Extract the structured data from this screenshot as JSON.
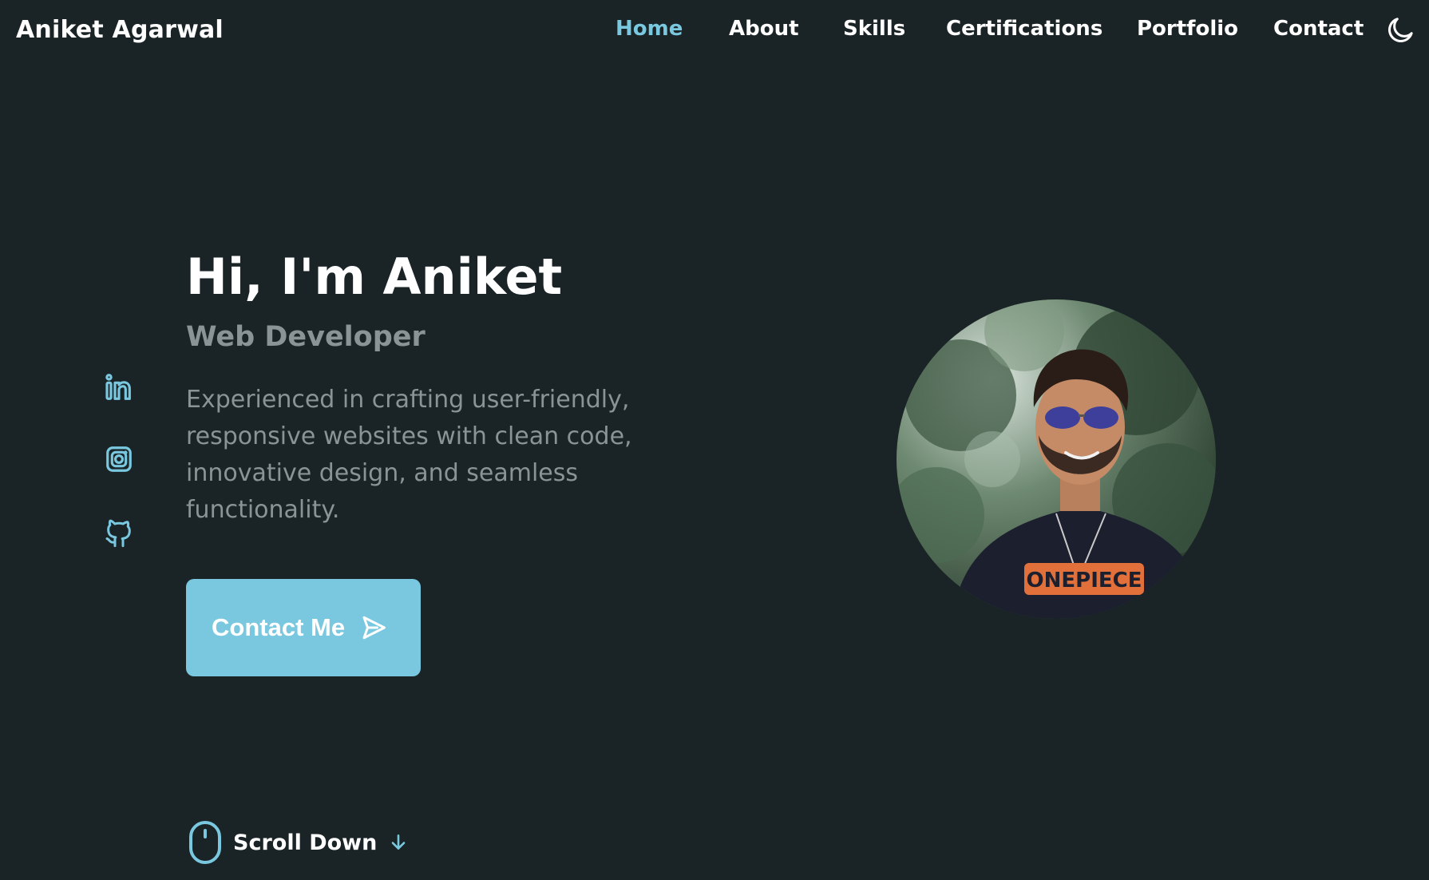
{
  "header": {
    "logo": "Aniket Agarwal",
    "nav": [
      {
        "label": "Home",
        "active": true
      },
      {
        "label": "About"
      },
      {
        "label": "Skills"
      },
      {
        "label": "Certifications"
      },
      {
        "label": "Portfolio"
      },
      {
        "label": "Contact"
      }
    ],
    "theme_icon": "moon-icon"
  },
  "hero": {
    "title": "Hi, I'm Aniket",
    "subtitle": "Web Developer",
    "description": "Experienced in crafting user-friendly, responsive websites with clean code, innovative design, and seamless functionality.",
    "cta_label": "Contact Me",
    "cta_icon": "send-icon"
  },
  "social": [
    {
      "icon": "linkedin-icon"
    },
    {
      "icon": "instagram-icon"
    },
    {
      "icon": "github-icon"
    }
  ],
  "scroll": {
    "label": "Scroll Down",
    "icons": [
      "mouse-icon",
      "arrow-down-icon"
    ]
  },
  "colors": {
    "background": "#1a2326",
    "accent": "#79c8df",
    "muted_text": "#8a9496",
    "text": "#ffffff"
  }
}
